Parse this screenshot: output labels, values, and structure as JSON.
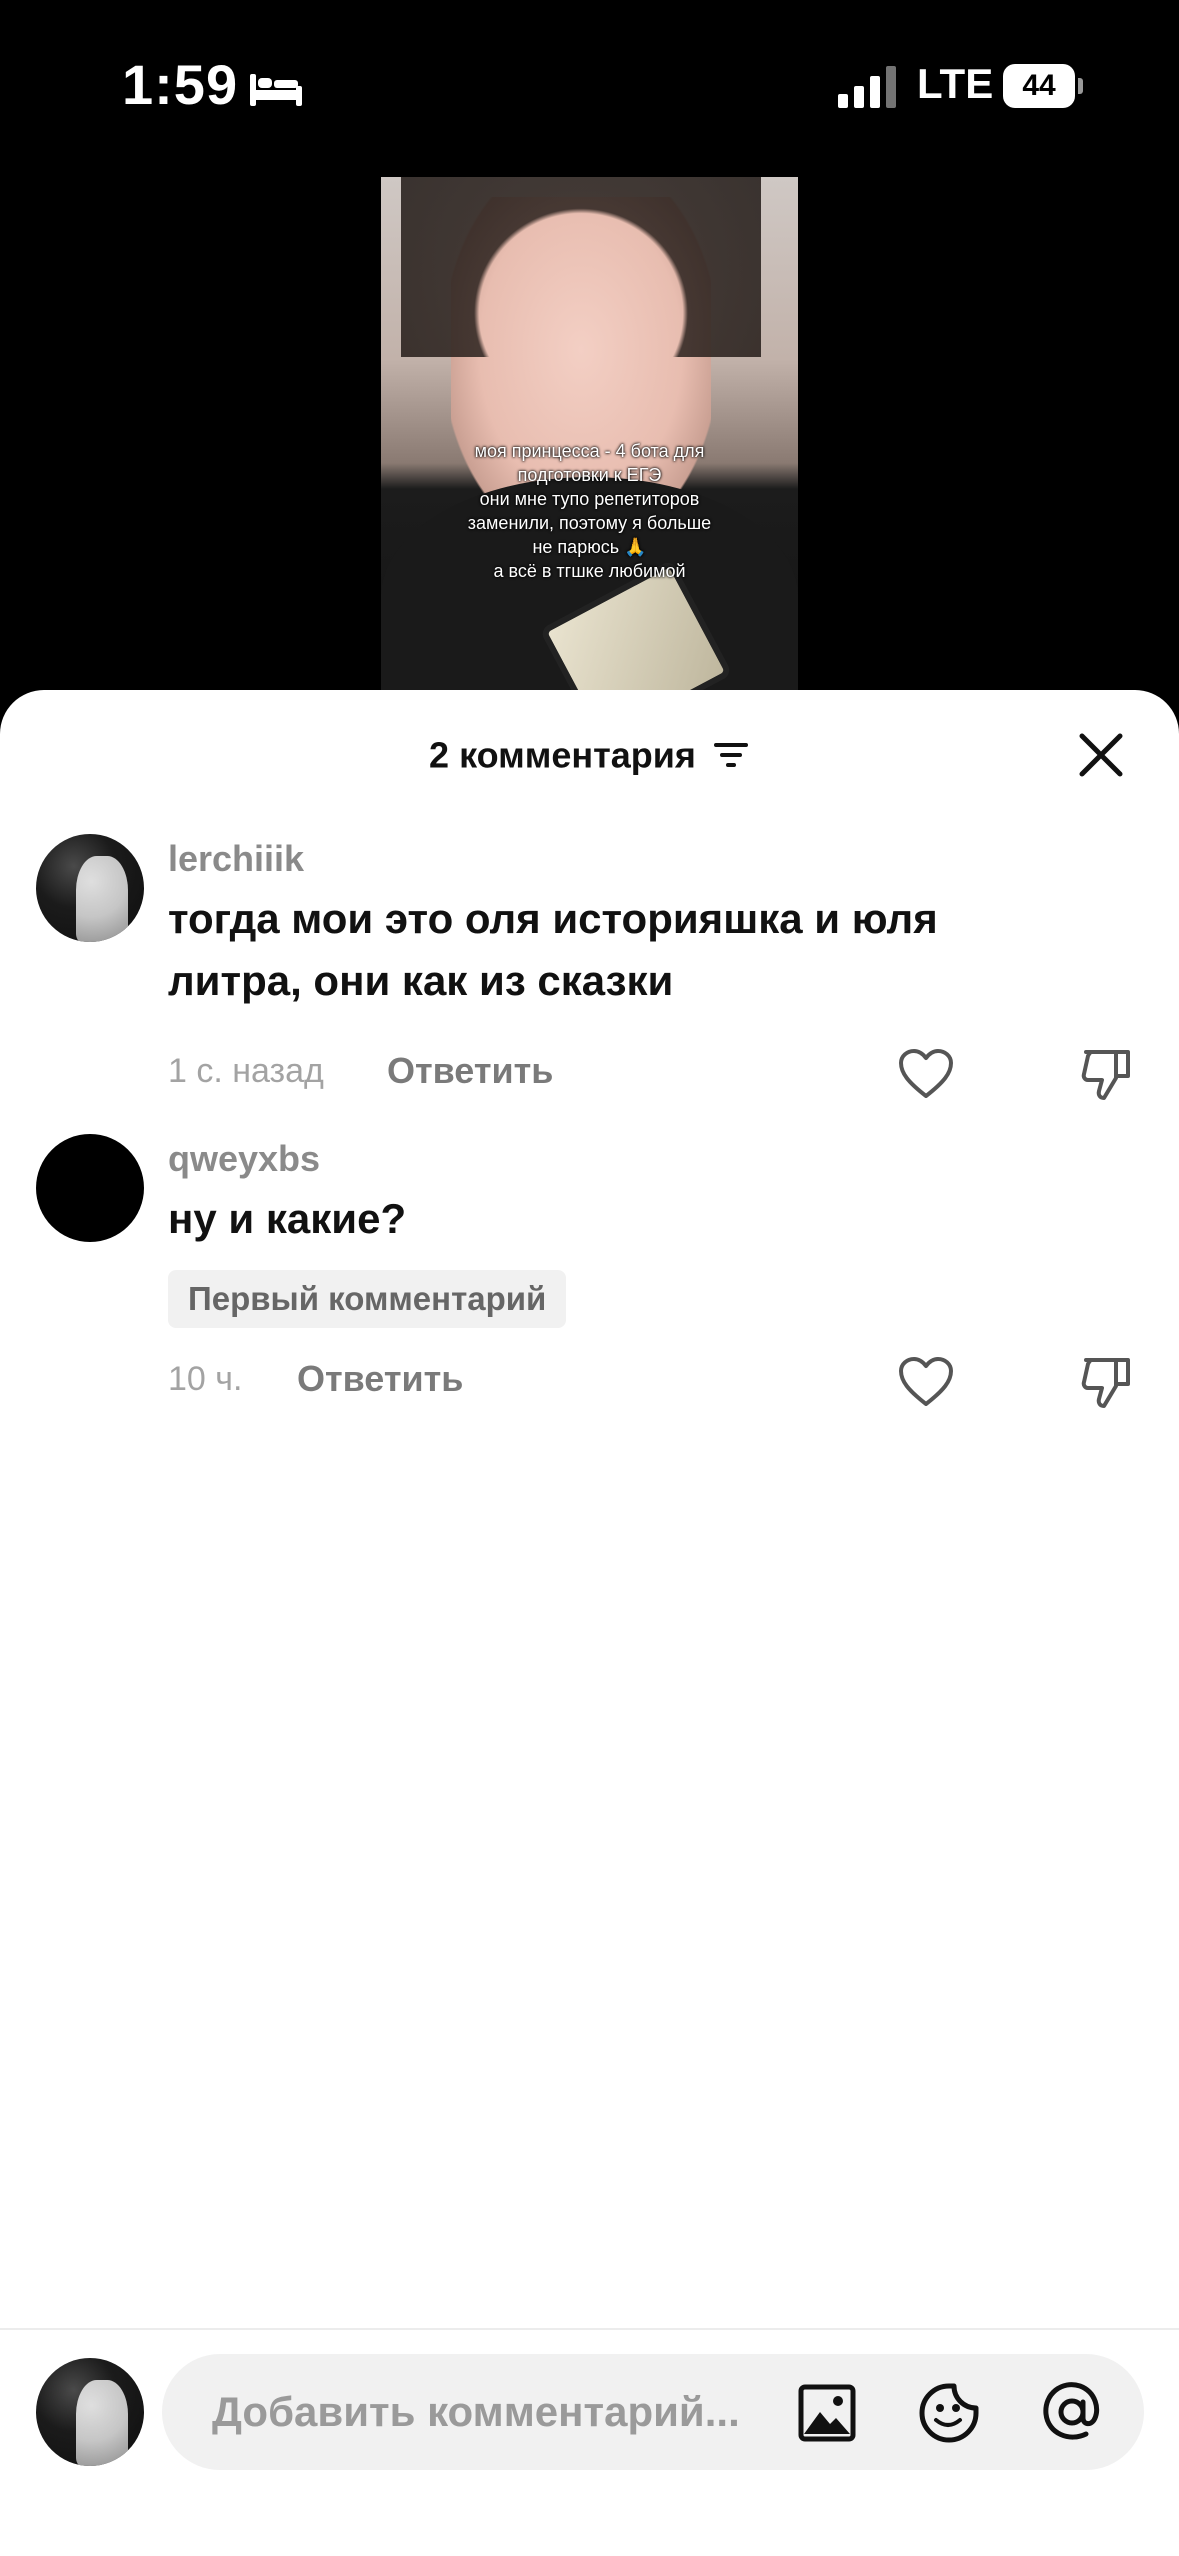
{
  "status_bar": {
    "time": "1:59",
    "network": "LTE",
    "battery_level": "44",
    "icons": [
      "bed-icon",
      "signal-icon",
      "battery-icon"
    ]
  },
  "video": {
    "caption": "моя принцесса - 4 бота для\nподготовки к ЕГЭ\nони мне тупо репетиторов\nзаменили, поэтому я больше\nне парюсь 🙏\nа всё в тгшке любимой"
  },
  "sheet": {
    "title": "2 комментария",
    "icons": [
      "sort-icon",
      "close-icon"
    ]
  },
  "comments": [
    {
      "username": "lerchiiik",
      "text": "тогда мои это оля историяшка и юля литра, они как из сказки",
      "time": "1 с. назад",
      "reply_label": "Ответить"
    },
    {
      "username": "qweyxbs",
      "text": "ну и какие?",
      "badge": "Первый комментарий",
      "time": "10 ч.",
      "reply_label": "Ответить"
    }
  ],
  "input": {
    "placeholder": "Добавить комментарий...",
    "icons": [
      "image-icon",
      "sticker-icon",
      "mention-icon"
    ]
  }
}
